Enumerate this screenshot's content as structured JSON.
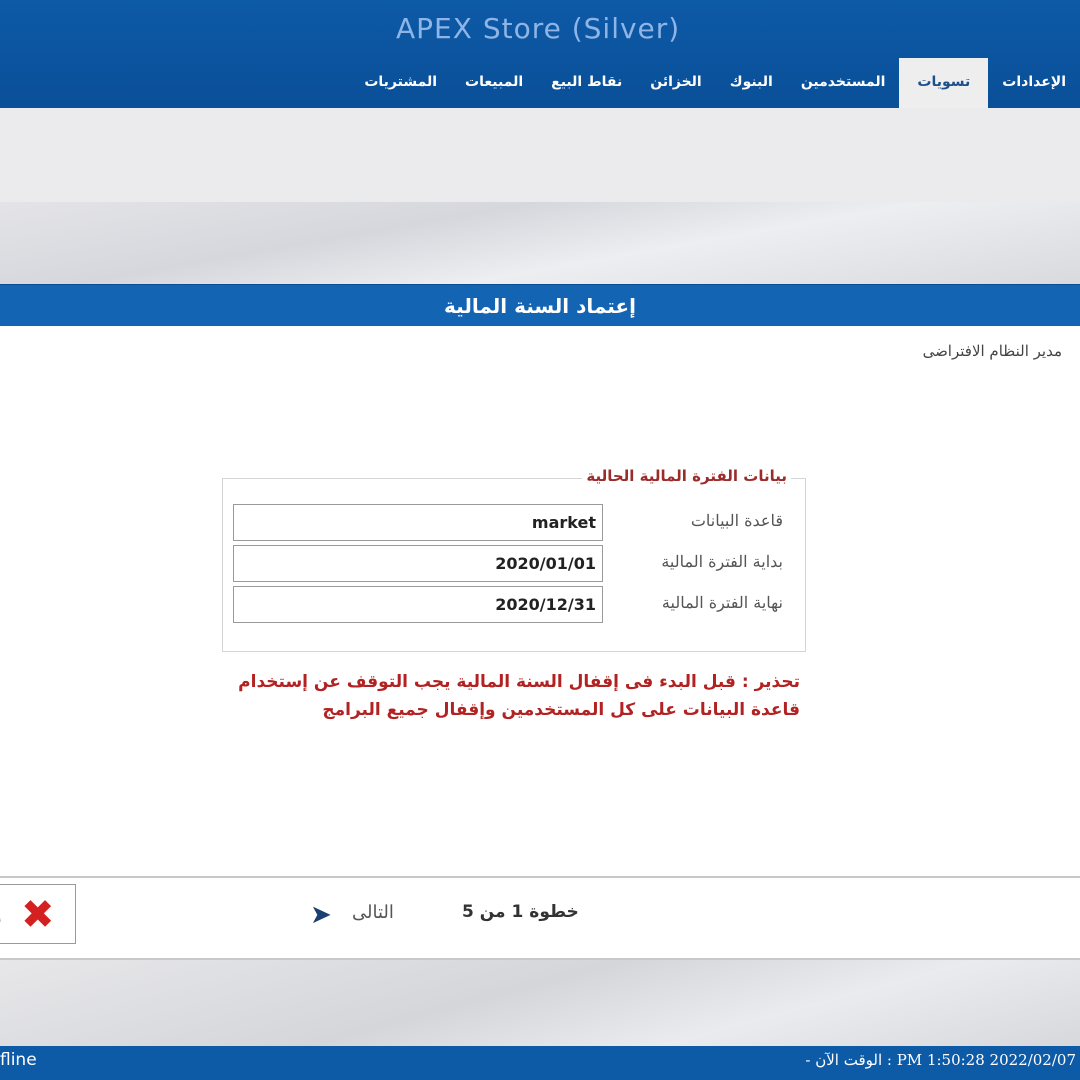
{
  "header": {
    "app_title": "APEX Store (Silver)",
    "menu": [
      {
        "label": "المشتريات"
      },
      {
        "label": "المبيعات"
      },
      {
        "label": "نقاط البيع"
      },
      {
        "label": "الخزائن"
      },
      {
        "label": "البنوك"
      },
      {
        "label": "المستخدمين"
      },
      {
        "label": "تسويات",
        "active": true
      },
      {
        "label": "الإعدادات"
      }
    ]
  },
  "page": {
    "title": "إعتماد السنة المالية",
    "user": "مدير النظام الافتراضى"
  },
  "form": {
    "legend": "بيانات الفترة المالية الحالية",
    "database_label": "قاعدة البيانات",
    "database_value": "market",
    "start_label": "بداية الفترة المالية",
    "start_value": "2020/01/01",
    "end_label": "نهاية الفترة المالية",
    "end_value": "2020/12/31"
  },
  "warning": "تحذير : قبل البدء فى إقفال السنة المالية يجب التوقف عن إستخدام قاعدة البيانات على كل المستخدمين وإقفال جميع البرامج",
  "wizard": {
    "close_partial": "إ",
    "next_label": "التالى",
    "step_text": "خطوة 1 من 5"
  },
  "status": {
    "left": "fline",
    "right": "PM 1:50:28 2022/02/07 : الوقت الآن -"
  }
}
